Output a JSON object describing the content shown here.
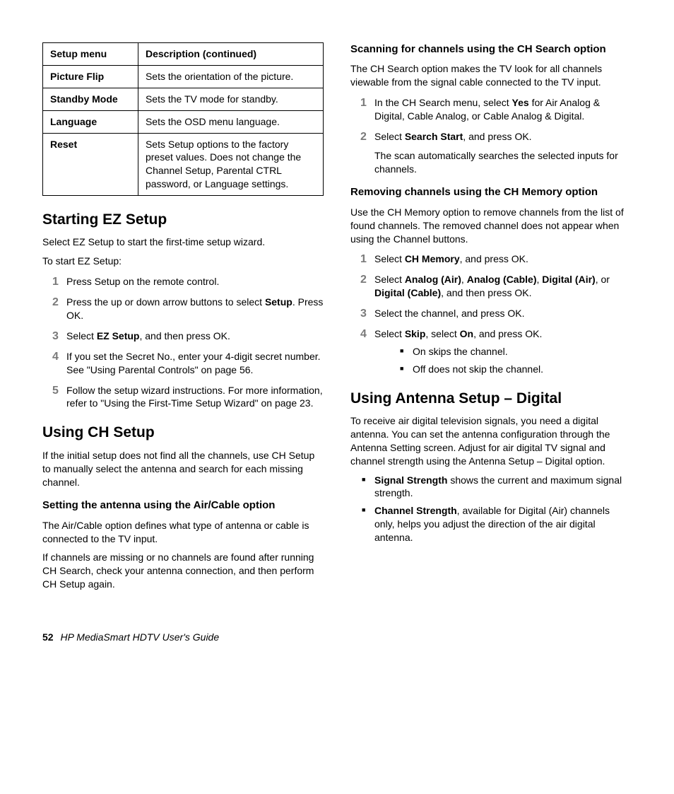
{
  "table": {
    "headers": [
      "Setup menu",
      "Description (continued)"
    ],
    "rows": [
      {
        "key": "Picture Flip",
        "desc": "Sets the orientation of the picture."
      },
      {
        "key": "Standby Mode",
        "desc": "Sets the TV mode for standby."
      },
      {
        "key": "Language",
        "desc": "Sets the OSD menu language."
      },
      {
        "key": "Reset",
        "desc": "Sets Setup options to the factory preset values. Does not change the Channel Setup, Parental CTRL password, or Language settings."
      }
    ]
  },
  "left": {
    "h_ez": "Starting EZ Setup",
    "p_ez1": "Select EZ Setup to start the first-time setup wizard.",
    "p_ez2": "To start EZ Setup:",
    "ez_steps": {
      "s1": "Press Setup on the remote control.",
      "s2a": "Press the up or down arrow buttons to select ",
      "s2b": "Setup",
      "s2c": ". Press OK.",
      "s3a": "Select ",
      "s3b": "EZ Setup",
      "s3c": ", and then press OK.",
      "s4": "If you set the Secret No., enter your 4-digit secret number. See \"Using Parental Controls\" on page 56.",
      "s5": "Follow the setup wizard instructions. For more information, refer to \"Using the First-Time Setup Wizard\" on page 23."
    },
    "h_ch": "Using CH Setup",
    "p_ch1": "If the initial setup does not find all the channels, use CH Setup to manually select the antenna and search for each missing channel.",
    "h_air": "Setting the antenna using the Air/Cable option",
    "p_air1": "The Air/Cable option defines what type of antenna or cable is connected to the TV input.",
    "p_air2": "If channels are missing or no channels are found after running CH Search, check your antenna connection, and then perform CH Setup again."
  },
  "right": {
    "h_scan": "Scanning for channels using the CH Search option",
    "p_scan1": "The CH Search option makes the TV look for all channels viewable from the signal cable connected to the TV input.",
    "scan_steps": {
      "s1a": "In the CH Search menu, select ",
      "s1b": "Yes",
      "s1c": " for Air Analog & Digital, Cable Analog, or Cable Analog & Digital.",
      "s2a": "Select ",
      "s2b": "Search Start",
      "s2c": ", and press OK.",
      "s2_sub": "The scan automatically searches the selected inputs for channels."
    },
    "h_rem": "Removing channels using the CH Memory option",
    "p_rem1": "Use the CH Memory option to remove channels from the list of found channels. The removed channel does not appear when using the Channel buttons.",
    "rem_steps": {
      "s1a": "Select ",
      "s1b": "CH Memory",
      "s1c": ", and press OK.",
      "s2a": "Select ",
      "s2b1": "Analog (Air)",
      "s2sep1": ", ",
      "s2b2": "Analog (Cable)",
      "s2sep2": ", ",
      "s2b3": "Digital (Air)",
      "s2sep3": ", or ",
      "s2b4": "Digital (Cable)",
      "s2c": ", and then press OK.",
      "s3": "Select the channel, and press OK.",
      "s4a": "Select ",
      "s4b": "Skip",
      "s4c": ", select ",
      "s4d": "On",
      "s4e": ", and press OK.",
      "s4_bullets": [
        "On skips the channel.",
        "Off does not skip the channel."
      ]
    },
    "h_ant": "Using Antenna Setup – Digital",
    "p_ant1": "To receive air digital television signals, you need a digital antenna. You can set the antenna configuration through the Antenna Setting screen. Adjust for air digital TV signal and channel strength using the Antenna Setup – Digital option.",
    "ant_bullets": {
      "b1a": "Signal Strength",
      "b1b": " shows the current and maximum signal strength.",
      "b2a": "Channel Strength",
      "b2b": ", available for Digital (Air) channels only, helps you adjust the direction of the air digital antenna."
    }
  },
  "footer": {
    "page": "52",
    "title": "HP MediaSmart HDTV User's Guide"
  },
  "nums": {
    "n1": "1",
    "n2": "2",
    "n3": "3",
    "n4": "4",
    "n5": "5"
  }
}
